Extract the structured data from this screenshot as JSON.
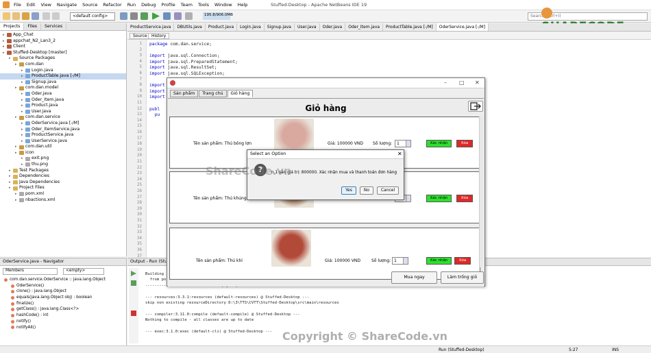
{
  "window": {
    "title": "Stuffed-Desktop - Apache NetBeans IDE 19",
    "menu": [
      "File",
      "Edit",
      "View",
      "Navigate",
      "Source",
      "Refactor",
      "Run",
      "Debug",
      "Profile",
      "Team",
      "Tools",
      "Window",
      "Help"
    ]
  },
  "toolbar": {
    "config": "<default config>",
    "memory": "195.8/906.0MB",
    "search_placeholder": "Search (Ctrl+I)"
  },
  "logo": {
    "text": "SHARECODE.vn"
  },
  "projects": {
    "tabs": [
      "Projects",
      "Files",
      "Services"
    ],
    "nodes": [
      {
        "label": "App_Chat",
        "icon": "proj",
        "indent": 0
      },
      {
        "label": "appchat_N2_Lan3_2",
        "icon": "proj",
        "indent": 0
      },
      {
        "label": "Client",
        "icon": "proj",
        "indent": 0
      },
      {
        "label": "Stuffed-Desktop [master]",
        "icon": "proj",
        "indent": 0
      },
      {
        "label": "Source Packages",
        "icon": "fold",
        "indent": 1
      },
      {
        "label": "com.dan",
        "icon": "pkg",
        "indent": 2
      },
      {
        "label": "Login.java",
        "icon": "java",
        "indent": 3
      },
      {
        "label": "ProductTable.java [-/M]",
        "icon": "java",
        "indent": 3,
        "selected": true
      },
      {
        "label": "Signup.java",
        "icon": "java",
        "indent": 3
      },
      {
        "label": "com.dan.model",
        "icon": "pkg",
        "indent": 2
      },
      {
        "label": "Oder.java",
        "icon": "java",
        "indent": 3
      },
      {
        "label": "Oder_Item.java",
        "icon": "java",
        "indent": 3
      },
      {
        "label": "Product.java",
        "icon": "java",
        "indent": 3
      },
      {
        "label": "User.java",
        "icon": "java",
        "indent": 3
      },
      {
        "label": "com.dan.service",
        "icon": "pkg",
        "indent": 2
      },
      {
        "label": "OderService.java [-/M]",
        "icon": "java",
        "indent": 3
      },
      {
        "label": "Oder_ItemService.java",
        "icon": "java",
        "indent": 3
      },
      {
        "label": "ProductService.java",
        "icon": "java",
        "indent": 3
      },
      {
        "label": "UserService.java",
        "icon": "java",
        "indent": 3
      },
      {
        "label": "com.dan.util",
        "icon": "pkg",
        "indent": 2
      },
      {
        "label": "icon",
        "icon": "pkg",
        "indent": 2
      },
      {
        "label": "exit.png",
        "icon": "file",
        "indent": 3
      },
      {
        "label": "thu.png",
        "icon": "file",
        "indent": 3
      },
      {
        "label": "Test Packages",
        "icon": "fold",
        "indent": 1
      },
      {
        "label": "Dependencies",
        "icon": "fold",
        "indent": 1
      },
      {
        "label": "Java Dependencies",
        "icon": "fold",
        "indent": 1
      },
      {
        "label": "Project Files",
        "icon": "fold",
        "indent": 1
      },
      {
        "label": "pom.xml",
        "icon": "file",
        "indent": 2
      },
      {
        "label": "nbactions.xml",
        "icon": "file",
        "indent": 2
      }
    ]
  },
  "navigator": {
    "title": "OderService.java - Navigator",
    "filter1": "Members",
    "filter2": "<empty>",
    "items": [
      "com.dan.service.OderService :: java.lang.Object",
      "OderService()",
      "clone() : java.lang.Object",
      "equals(java.lang.Object obj) : boolean",
      "finalize()",
      "getClass() : java.lang.Class<?>",
      "hashCode() : int",
      "notify()",
      "notifyAll()"
    ]
  },
  "editor": {
    "tabs": [
      "ProductService.java",
      "DBUtils.java",
      "Product.java",
      "Login.java",
      "Signup.java",
      "User.java",
      "Oder.java",
      "Oder_Item.java",
      "ProductTable.java [-/M]",
      "OderService.java [-/M]"
    ],
    "active_tab": 9,
    "buttons": [
      "Source",
      "History"
    ],
    "line_numbers": [
      "1",
      "2",
      "3",
      "4",
      "5",
      "6",
      "7",
      "8",
      "9",
      "10",
      "11",
      "12",
      "13",
      "14",
      "15",
      "16",
      "17",
      "18",
      "19",
      "20",
      "21",
      "22",
      "23",
      "24",
      "25",
      "26",
      "27",
      "28",
      "29",
      "30",
      "31",
      "32",
      "33",
      "34",
      "35",
      "36",
      "37"
    ],
    "lines": [
      {
        "kw": "package",
        "rest": " com.dan.service;"
      },
      {
        "kw": "",
        "rest": ""
      },
      {
        "kw": "import",
        "rest": " java.sql.Connection;"
      },
      {
        "kw": "import",
        "rest": " java.sql.PreparedStatement;"
      },
      {
        "kw": "import",
        "rest": " java.sql.ResultSet;"
      },
      {
        "kw": "import",
        "rest": " java.sql.SQLException;"
      },
      {
        "kw": "",
        "rest": ""
      },
      {
        "kw": "import",
        "rest": ""
      },
      {
        "kw": "import",
        "rest": ""
      },
      {
        "kw": "import",
        "rest": ""
      },
      {
        "kw": "",
        "rest": ""
      },
      {
        "kw": "publ",
        "rest": ""
      },
      {
        "kw": "  pu",
        "rest": ""
      }
    ]
  },
  "output": {
    "title": "Output - Run (Stuffed-Desktop)",
    "lines": [
      "Building",
      "  from po",
      "---------------------------------[ jar ]---------------------------------",
      "",
      "--- resources:3.3.1:resources (default-resources) @ Stuffed-Desktop ---",
      "skip non existing resourceDirectory D:\\3\\TTS\\CVTT\\Stuffed-Desktop\\src\\main\\resources",
      "",
      "--- compiler:3.11.0:compile (default-compile) @ Stuffed-Desktop ---",
      "Nothing to compile - all classes are up to date",
      "",
      "--- exec:3.1.0:exec (default-cli) @ Stuffed-Desktop ---"
    ]
  },
  "statusbar": {
    "run": "Run (Stuffed-Desktop)",
    "position": "5:27",
    "mode": "INS"
  },
  "app": {
    "tabs": [
      "Sản phẩm",
      "Trang chủ",
      "Giỏ hàng"
    ],
    "active_tab": 2,
    "heading": "Giỏ hàng",
    "items": [
      {
        "name": "Tên sản phẩm: Thú bông lợn",
        "price": "Giá: 100000 VND",
        "qty_label": "Số lượng:",
        "qty": "1",
        "confirm": "Xác nhận",
        "delete": "Xóa",
        "img": "#d9a9a0"
      },
      {
        "name": "Tên sản phẩm: Thú khủng lồ",
        "price": "",
        "qty_label": "",
        "qty": "1",
        "confirm": "Xác nhận",
        "delete": "Xóa",
        "img": "#8a5a3a"
      },
      {
        "name": "Tên sản phẩm: Thú khỉ",
        "price": "Giá: 100000 VND",
        "qty_label": "Số lượng:",
        "qty": "1",
        "confirm": "Xác nhận",
        "delete": "Xóa",
        "img": "#b24a3a"
      }
    ],
    "buy_button": "Mua ngay",
    "clear_button": "Làm trống giỏ"
  },
  "dialog": {
    "title": "Select an Option",
    "message": "n 1 sản giá trị: 800000. Xác nhận mua và thanh toán đơn hàng",
    "yes": "Yes",
    "no": "No",
    "cancel": "Cancel"
  },
  "watermark": {
    "center": "ShareCode.vn",
    "copyright": "Copyright © ShareCode.vn"
  }
}
